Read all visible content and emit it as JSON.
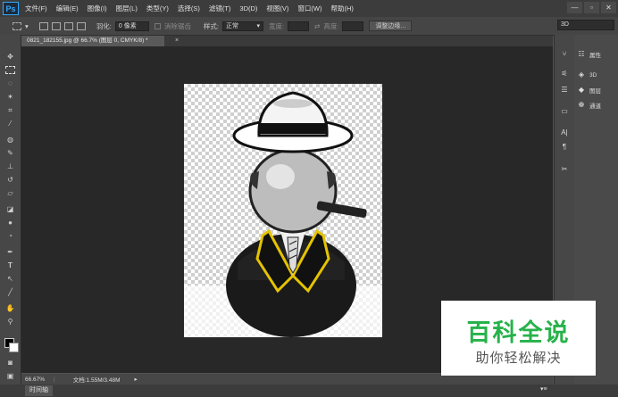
{
  "app": {
    "logo": "Ps"
  },
  "menu": [
    "文件(F)",
    "编辑(E)",
    "图像(I)",
    "图层(L)",
    "类型(Y)",
    "选择(S)",
    "滤镜(T)",
    "3D(D)",
    "视图(V)",
    "窗口(W)",
    "帮助(H)"
  ],
  "window_controls": {
    "minimize": "—",
    "restore": "▫",
    "close": "✕"
  },
  "options": {
    "feather_label": "羽化:",
    "feather_value": "0 像素",
    "antialias_label": "消除锯齿",
    "style_label": "样式:",
    "style_value": "正常",
    "width_label": "宽度:",
    "height_label": "高度:",
    "refine_edge": "调整边缘...",
    "workspace": "3D"
  },
  "document": {
    "tab_title": "0821_182155.jpg @ 66.7% (图层 0, CMYK/8) *",
    "zoom": "66.67%",
    "doc_info": "文档:1.55M/3.48M"
  },
  "timeline": {
    "label": "时间轴"
  },
  "panels": {
    "properties": "属性",
    "threeD": "3D",
    "layers": "图层",
    "channels": "通道"
  },
  "watermark": {
    "title": "百科全说",
    "subtitle": "助你轻松解决"
  },
  "colors": {
    "accent": "#31a8ff",
    "watermark_green": "#27b24a"
  }
}
